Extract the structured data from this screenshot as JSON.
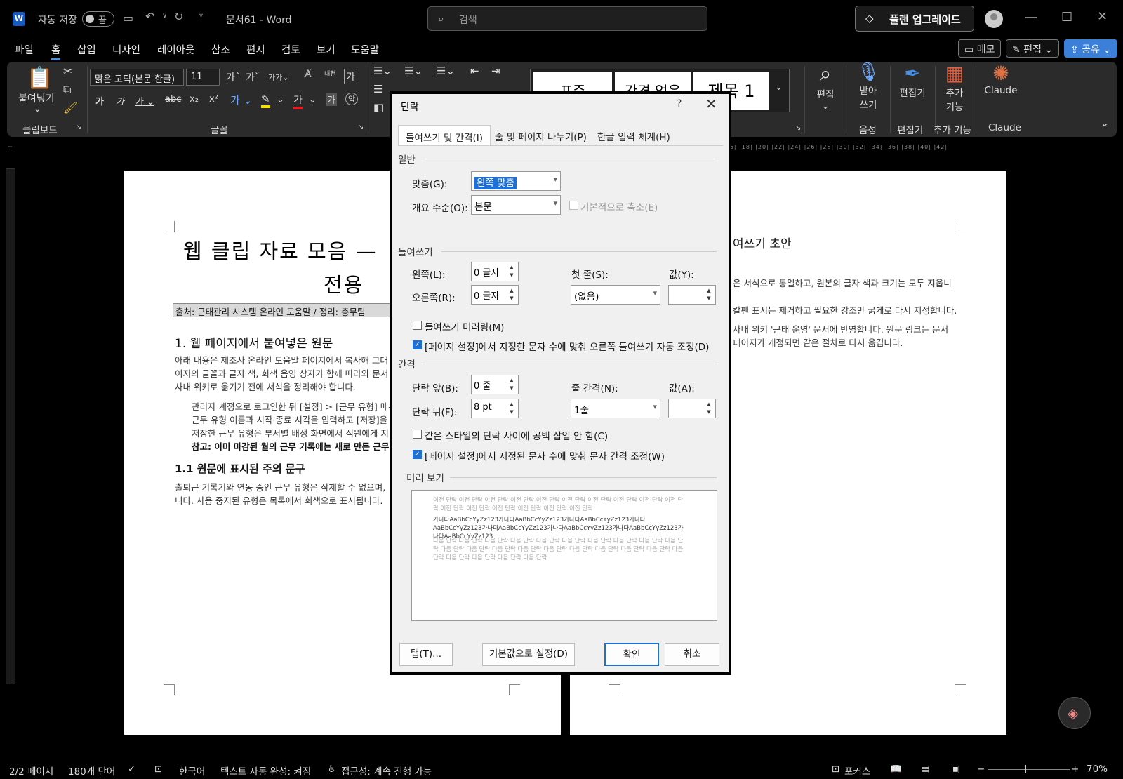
{
  "app": {
    "logo_letter": "W",
    "autosave_label": "자동 저장",
    "autosave_state": "끔",
    "doc_title": "문서61 - Word",
    "search_placeholder": "검색",
    "upgrade_label": "플랜 업그레이드"
  },
  "menu": [
    "파일",
    "홈",
    "삽입",
    "디자인",
    "레이아웃",
    "참조",
    "편지",
    "검토",
    "보기",
    "도움말"
  ],
  "menu_active": "홈",
  "ribbon_right": {
    "memo": "메모",
    "edit": "편집",
    "share": "공유"
  },
  "ribbon": {
    "paste": "붙여넣기",
    "clipboard": "클립보드",
    "font_name": "맑은 고딕(본문 한글)",
    "font_size": "11",
    "font_group": "글꼴",
    "styles": [
      "표준",
      "간격 없음",
      "제목 1"
    ],
    "find": "편집",
    "dictate_line1": "받아",
    "dictate_line2": "쓰기",
    "voice": "음성",
    "editor": "편집기",
    "editor_group": "편집기",
    "addins_line1": "추가",
    "addins_line2": "기능",
    "addins_group": "추가 기능",
    "claude": "Claude",
    "claude_group": "Claude"
  },
  "ruler_ticks": "|16| |18| |20| |22| |24| |26| |28| |30| |32| |34| |36| |38| |40| |42|",
  "doc": {
    "title_line1": "웹 클립 자료 모음 — ",
    "title_line2": "전용",
    "source": "출처: 근태관리 시스템 온라인 도움말 / 정리: 총무팀",
    "h1": "1. 웹 페이지에서 붙여넣은 원문",
    "p1": [
      "아래 내용은 제조사 온라인 도움말 페이지에서 복사해 그대",
      "이지의 글꼴과 글자 색, 회색 음영 상자가 함께 따라와 문서",
      "사내 위키로 옮기기 전에 서식을 정리해야 합니다."
    ],
    "p2": [
      "관리자 계정으로 로그인한 뒤 [설정] > [근무 유형] 메뉴",
      "근무 유형 이름과 시작·종료 시각을 입력하고 [저장]을",
      "저장한 근무 유형은 부서별 배정 화면에서 직원에게 지"
    ],
    "note": "참고: 이미 마감된 월의 근무 기록에는 새로 만든 근무",
    "h2": "1.1 원문에 표시된 주의 문구",
    "p3": [
      "출퇴근 기록기와 연동 중인 근무 유형은 삭제할 수 없으며,",
      "니다. 사용 중지된 유형은 목록에서 회색으로 표시됩니다."
    ],
    "r_heading": "여쓰기 초안",
    "r_lines": [
      "은 서식으로 통일하고, 원본의 글자 색과 크기는 모두 지웁니",
      "칼펜 표시는 제거하고 필요한 강조만 굵게로 다시 지정합니다.",
      "사내 위키 '근태 운영' 문서에 반영합니다. 원문 링크는 문서",
      "페이지가 개정되면 같은 절차로 다시 옮깁니다."
    ]
  },
  "dialog": {
    "title": "단락",
    "help": "?",
    "tabs": [
      "들여쓰기 및 간격(I)",
      "줄 및 페이지 나누기(P)",
      "한글 입력 체계(H)"
    ],
    "general": "일반",
    "align_label": "맞춤(G):",
    "align_value": "왼쪽 맞춤",
    "outline_label": "개요 수준(O):",
    "outline_value": "본문",
    "collapse_label": "기본적으로 축소(E)",
    "indent": "들여쓰기",
    "left_label": "왼쪽(L):",
    "left_value": "0 글자",
    "right_label": "오른쪽(R):",
    "right_value": "0 글자",
    "special_label": "첫 줄(S):",
    "special_value": "(없음)",
    "by_label": "값(Y):",
    "mirror_label": "들여쓰기 미러링(M)",
    "auto_right_label": "[페이지 설정]에서 지정한 문자 수에 맞춰 오른쪽 들여쓰기 자동 조정(D)",
    "spacing": "간격",
    "before_label": "단락 앞(B):",
    "before_value": "0 줄",
    "after_label": "단락 뒤(F):",
    "after_value": "8 pt",
    "line_label": "줄 간격(N):",
    "line_value": "1줄",
    "at_label": "값(A):",
    "no_space_label": "같은 스타일의 단락 사이에 공백 삽입 안 함(C)",
    "snap_grid_label": "[페이지 설정]에서 지정된 문자 수에 맞춰 문자 간격 조정(W)",
    "preview": "미리 보기",
    "preview_prev": "이전 단락 이전 단락 이전 단락 이전 단락 이전 단락 이전 단락 이전 단락 이전 단락 이전 단락 이전 단락 이전 단락 이전 단락 이전 단락 이전 단락 이전 단락 이전 단락",
    "preview_cur": "가나다AaBbCcYyZz123가나다AaBbCcYyZz123가나다AaBbCcYyZz123가나다AaBbCcYyZz123가나다AaBbCcYyZz123가나다AaBbCcYyZz123가나다AaBbCcYyZz123가나다AaBbCcYyZz123",
    "preview_next": "다음 단락 다음 단락 다음 단락 다음 단락 다음 단락 다음 단락 다음 단락 다음 단락 다음 단락 다음 단락 다음 단락 다음 단락 다음 단락 다음 단락 다음 단락 다음 단락 다음 단락 다음 단락 다음 단락 다음 단락 다음 단락 다음 단락 다음 단락 다음 단락",
    "tabs_btn": "탭(T)...",
    "default_btn": "기본값으로 설정(D)",
    "ok": "확인",
    "cancel": "취소"
  },
  "status": {
    "page": "2/2 페이지",
    "words": "180개 단어",
    "lang": "한국어",
    "autocomplete": "텍스트 자동 완성: 켜짐",
    "accessibility": "접근성: 계속 진행 가능",
    "focus": "포커스",
    "zoom": "70%"
  },
  "colors": {
    "accent": "#1e6fd6",
    "ribbon": "#2b2b2b",
    "share": "#3b7fd8"
  }
}
